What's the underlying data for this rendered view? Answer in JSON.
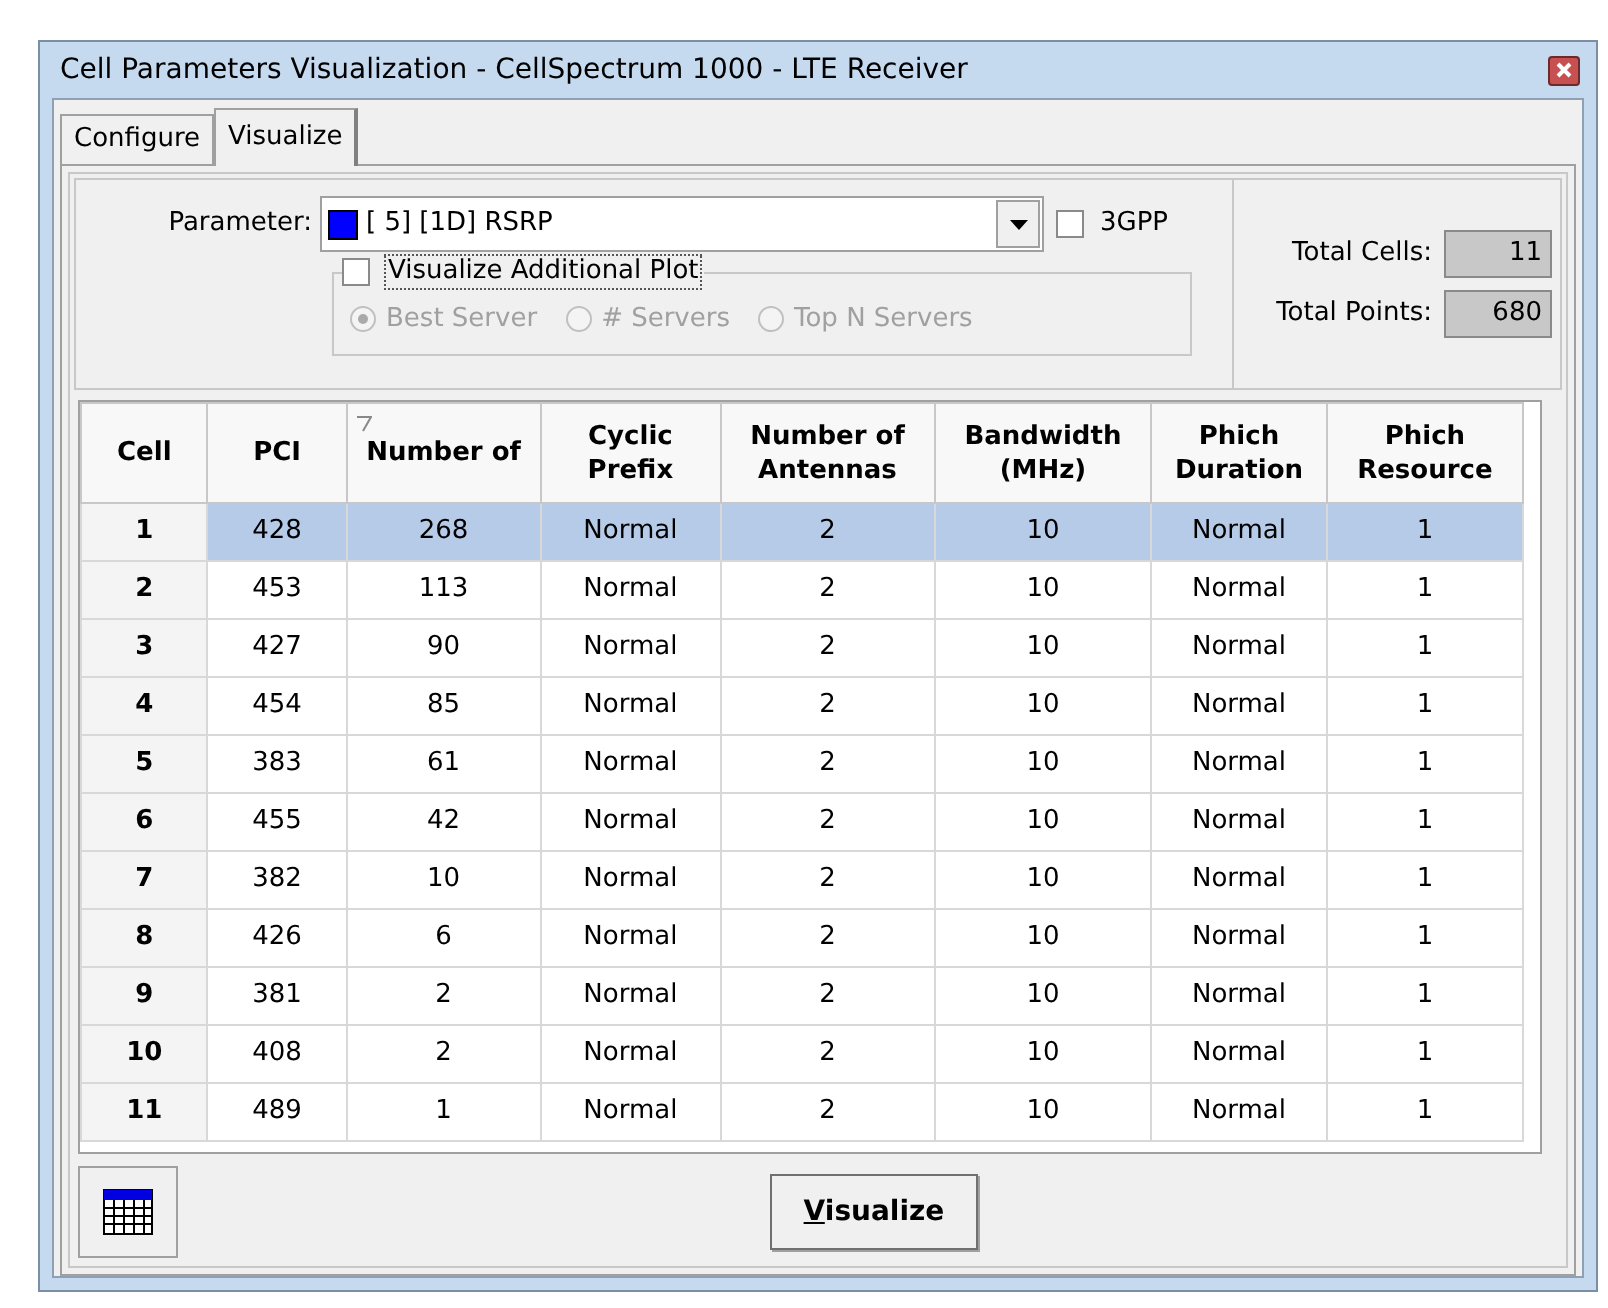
{
  "window": {
    "title": "Cell Parameters Visualization - CellSpectrum 1000 - LTE Receiver"
  },
  "tabs": [
    {
      "label": "Configure",
      "selected": false
    },
    {
      "label": "Visualize",
      "selected": true
    }
  ],
  "parameter": {
    "label": "Parameter:",
    "value": "[ 5] [1D] RSRP",
    "color": "#0000ff"
  },
  "gpp": {
    "label": "3GPP",
    "checked": false
  },
  "additional_plot": {
    "label": "Visualize Additional Plot",
    "checked": false,
    "options": [
      {
        "label": "Best Server",
        "selected": true,
        "disabled": true
      },
      {
        "label": "# Servers",
        "selected": false,
        "disabled": true
      },
      {
        "label": "Top N Servers",
        "selected": false,
        "disabled": true
      }
    ]
  },
  "totals": [
    {
      "label": "Total Cells:",
      "value": "11"
    },
    {
      "label": "Total Points:",
      "value": "680"
    }
  ],
  "table": {
    "columns": [
      {
        "label": "Cell",
        "sorted": false
      },
      {
        "label": "PCI",
        "sorted": false
      },
      {
        "label": "Number of",
        "sorted": true
      },
      {
        "label": "Cyclic Prefix",
        "sorted": false
      },
      {
        "label": "Number of Antennas",
        "sorted": false
      },
      {
        "label": "Bandwidth (MHz)",
        "sorted": false
      },
      {
        "label": "Phich Duration",
        "sorted": false
      },
      {
        "label": "Phich Resource",
        "sorted": false
      }
    ],
    "rows": [
      {
        "selected": true,
        "cells": [
          "1",
          "428",
          "268",
          "Normal",
          "2",
          "10",
          "Normal",
          "1"
        ]
      },
      {
        "selected": false,
        "cells": [
          "2",
          "453",
          "113",
          "Normal",
          "2",
          "10",
          "Normal",
          "1"
        ]
      },
      {
        "selected": false,
        "cells": [
          "3",
          "427",
          "90",
          "Normal",
          "2",
          "10",
          "Normal",
          "1"
        ]
      },
      {
        "selected": false,
        "cells": [
          "4",
          "454",
          "85",
          "Normal",
          "2",
          "10",
          "Normal",
          "1"
        ]
      },
      {
        "selected": false,
        "cells": [
          "5",
          "383",
          "61",
          "Normal",
          "2",
          "10",
          "Normal",
          "1"
        ]
      },
      {
        "selected": false,
        "cells": [
          "6",
          "455",
          "42",
          "Normal",
          "2",
          "10",
          "Normal",
          "1"
        ]
      },
      {
        "selected": false,
        "cells": [
          "7",
          "382",
          "10",
          "Normal",
          "2",
          "10",
          "Normal",
          "1"
        ]
      },
      {
        "selected": false,
        "cells": [
          "8",
          "426",
          "6",
          "Normal",
          "2",
          "10",
          "Normal",
          "1"
        ]
      },
      {
        "selected": false,
        "cells": [
          "9",
          "381",
          "2",
          "Normal",
          "2",
          "10",
          "Normal",
          "1"
        ]
      },
      {
        "selected": false,
        "cells": [
          "10",
          "408",
          "2",
          "Normal",
          "2",
          "10",
          "Normal",
          "1"
        ]
      },
      {
        "selected": false,
        "cells": [
          "11",
          "489",
          "1",
          "Normal",
          "2",
          "10",
          "Normal",
          "1"
        ]
      }
    ]
  },
  "visualize_button": {
    "label": "Visualize"
  }
}
